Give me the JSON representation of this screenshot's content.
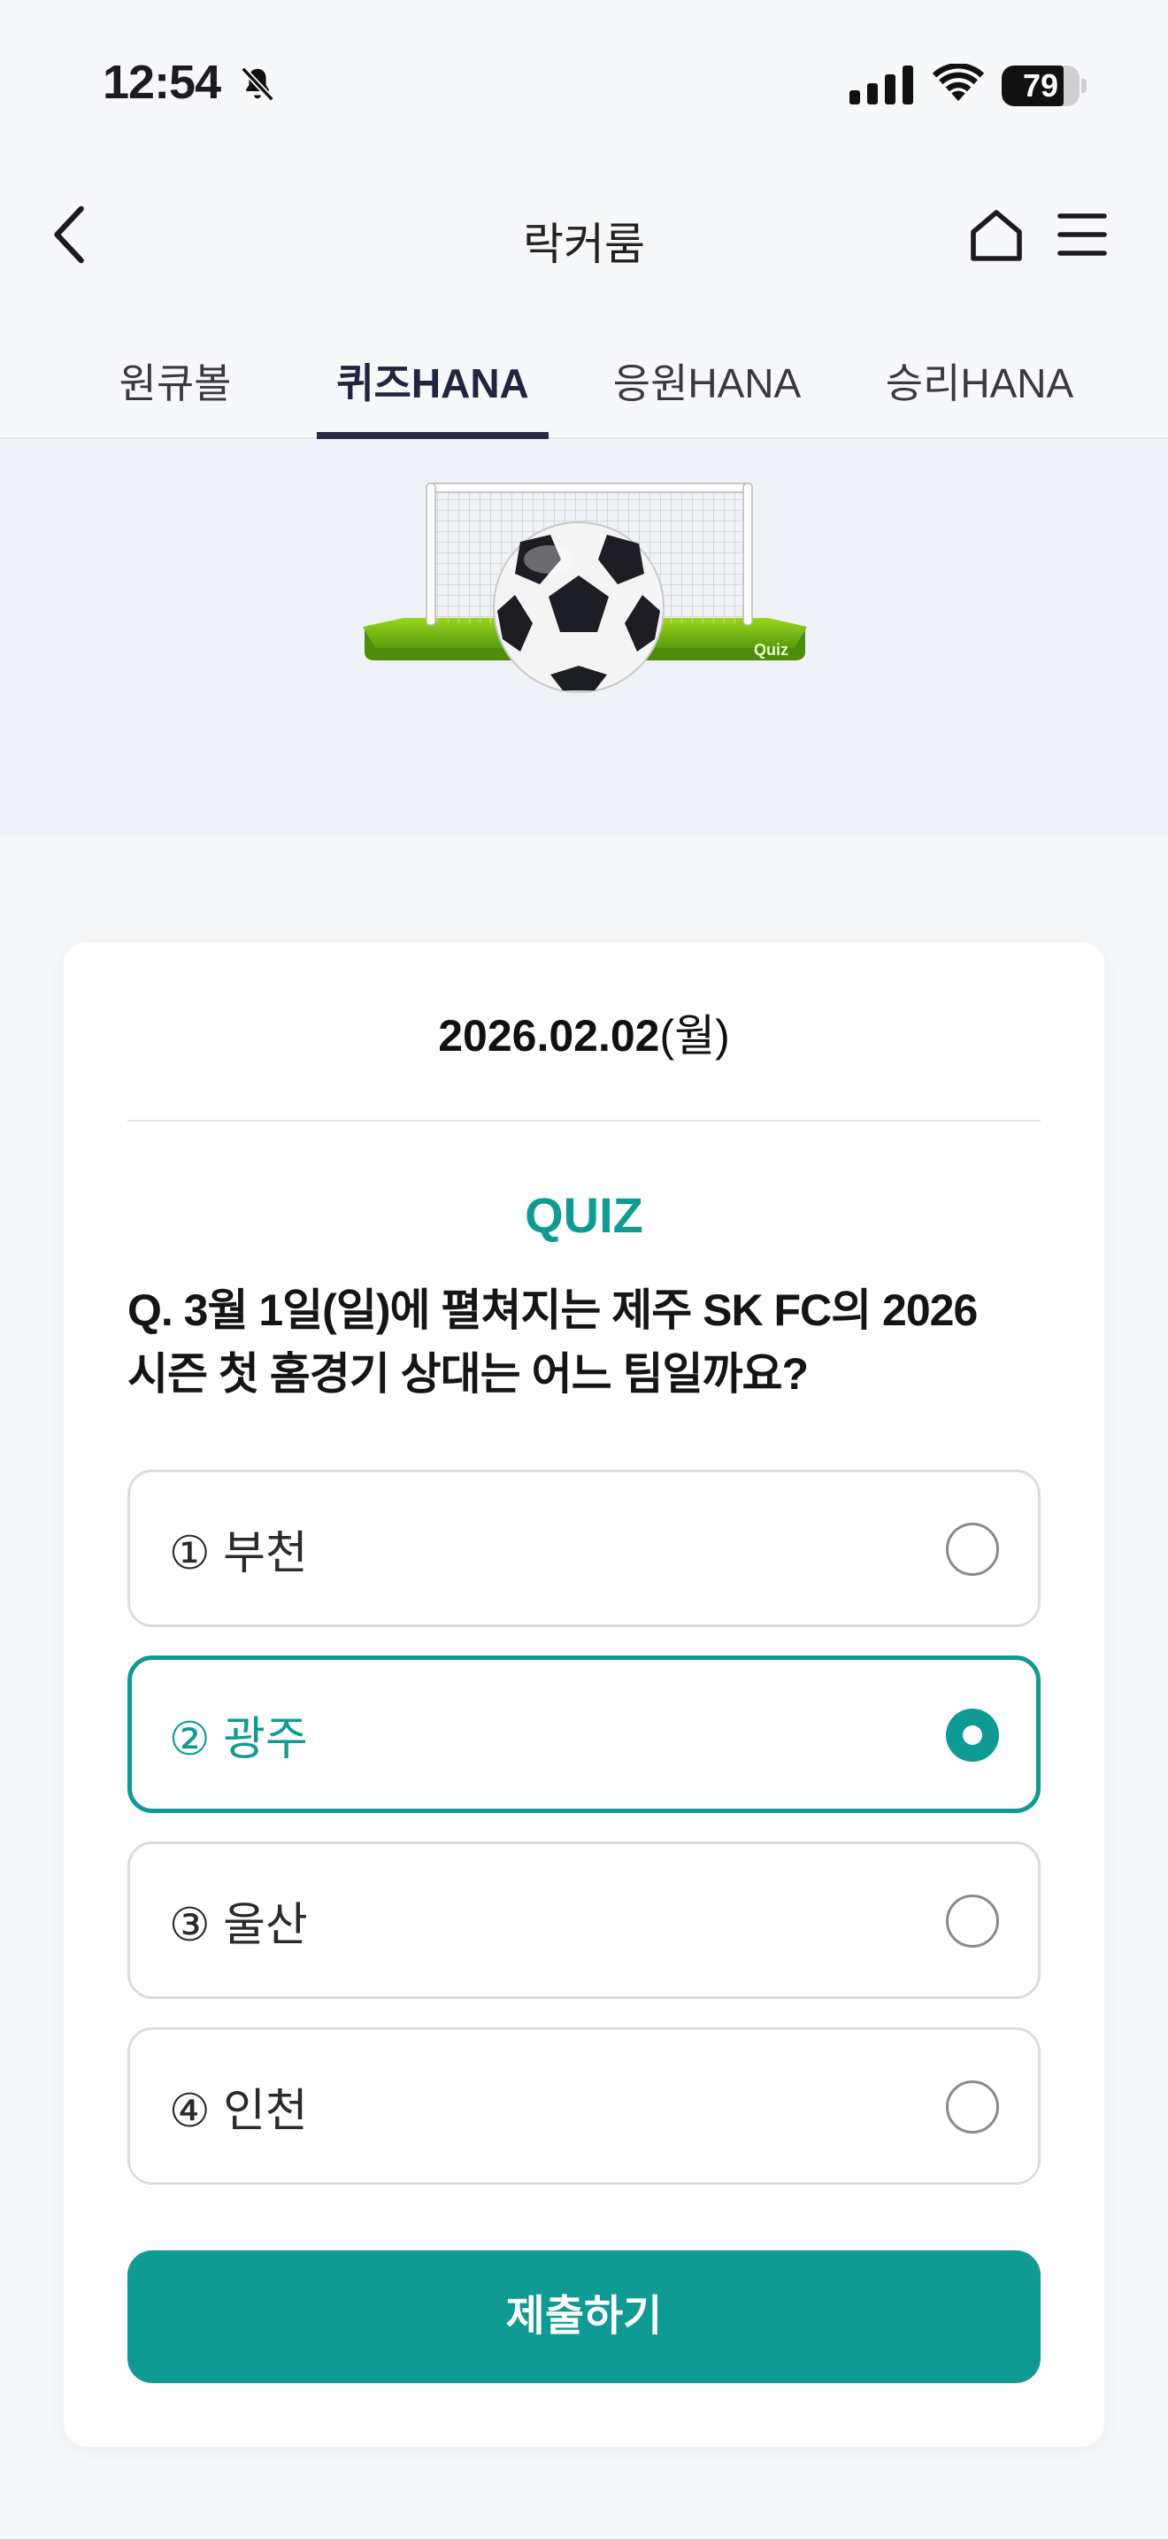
{
  "status_bar": {
    "time": "12:54",
    "battery_level": "79",
    "battery_fraction": 0.79
  },
  "header": {
    "title": "락커룸",
    "back_icon": "chevron-left-icon",
    "home_icon": "home-icon",
    "menu_icon": "hamburger-menu-icon"
  },
  "tabs": [
    {
      "label": "원큐볼",
      "active": false
    },
    {
      "label": "퀴즈HANA",
      "active": true
    },
    {
      "label": "응원HANA",
      "active": false
    },
    {
      "label": "승리HANA",
      "active": false
    }
  ],
  "banner": {
    "badge": "Quiz"
  },
  "quiz": {
    "date": "2026.02.02",
    "day_of_week": "(월)",
    "label": "QUIZ",
    "question_line1": "Q. 3월 1일(일)에 펼쳐지는 제주 SK FC의 2026",
    "question_line2": "시즌 첫 홈경기 상대는 어느 팀일까요?",
    "options": [
      {
        "label": "① 부천",
        "selected": false
      },
      {
        "label": "② 광주",
        "selected": true
      },
      {
        "label": "③ 울산",
        "selected": false
      },
      {
        "label": "④ 인천",
        "selected": false
      }
    ],
    "submit_label": "제출하기"
  },
  "colors": {
    "accent": "#0f9a94",
    "tab_active": "#262a45",
    "banner_bg": "#eff2f6",
    "page_bg": "#f6f8fa"
  }
}
